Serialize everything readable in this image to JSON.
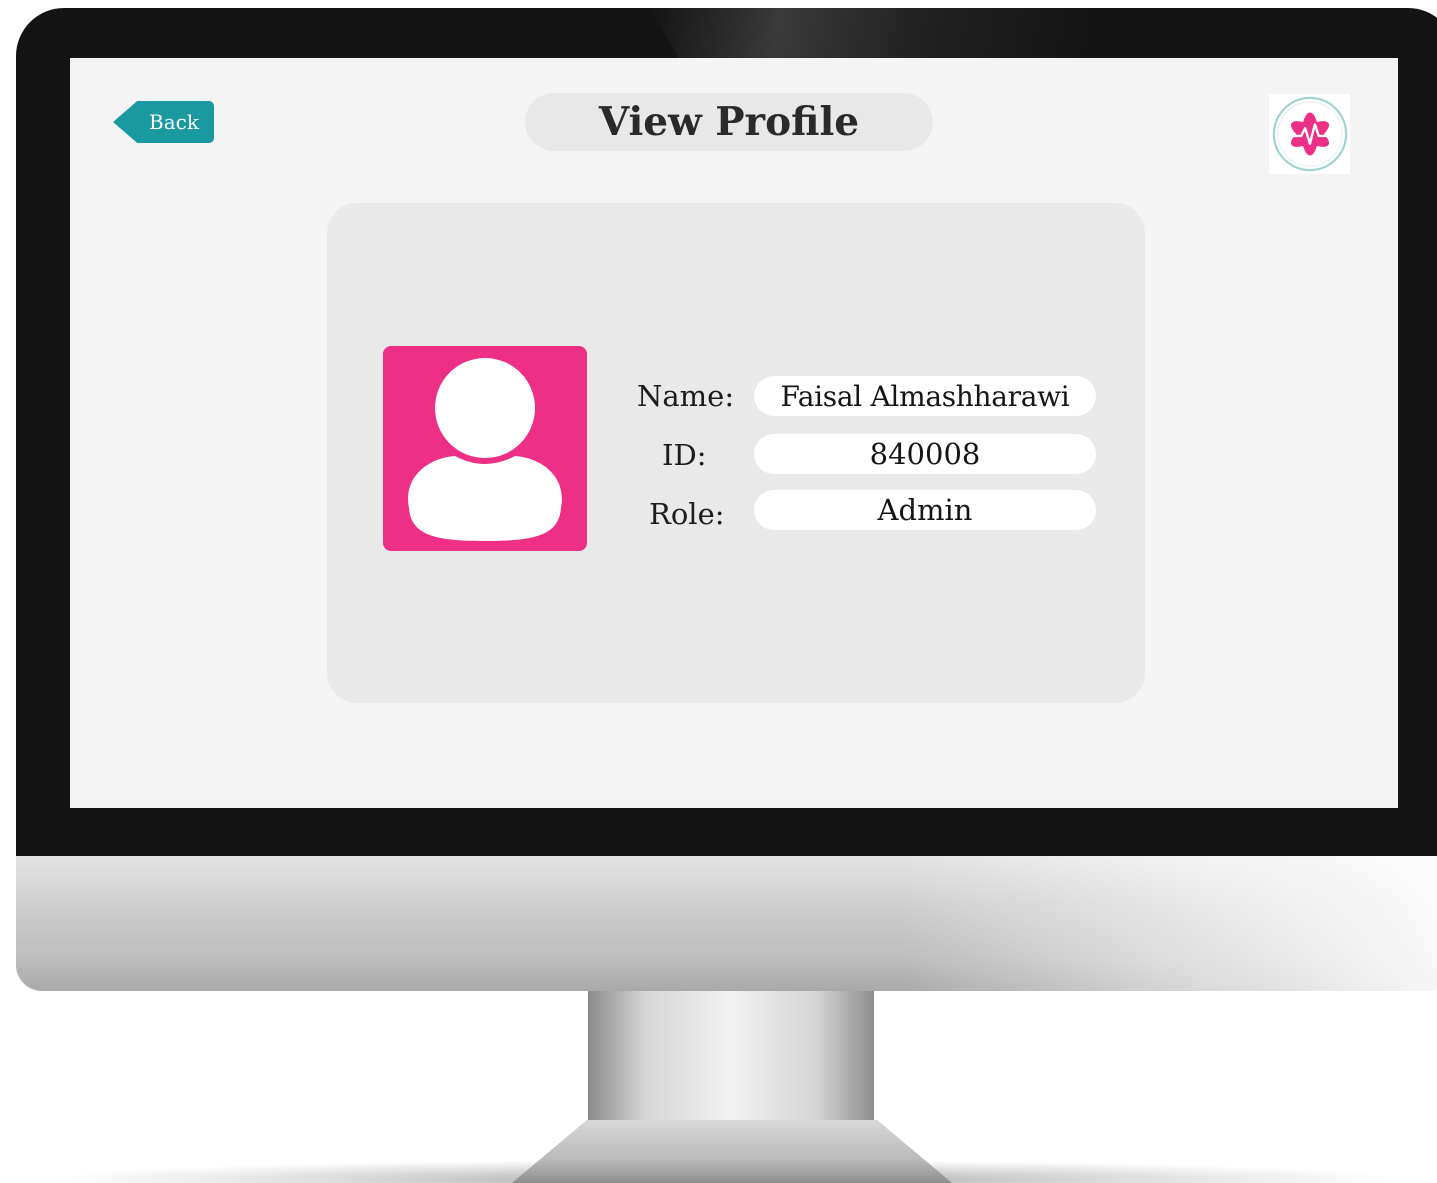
{
  "header": {
    "back_label": "Back",
    "title": "View Profile"
  },
  "icons": {
    "logo": "medical-star-heartbeat-icon",
    "avatar": "user-silhouette-icon"
  },
  "profile": {
    "fields": [
      {
        "label": "Name:",
        "value": "Faisal Almashharawi"
      },
      {
        "label": "ID:",
        "value": "840008"
      },
      {
        "label": "Role:",
        "value": "Admin"
      }
    ]
  },
  "colors": {
    "accent_teal": "#1a9aa0",
    "accent_pink": "#ee2f86",
    "screen_background": "#f4f4f4",
    "card_background": "#e9e9e9"
  }
}
